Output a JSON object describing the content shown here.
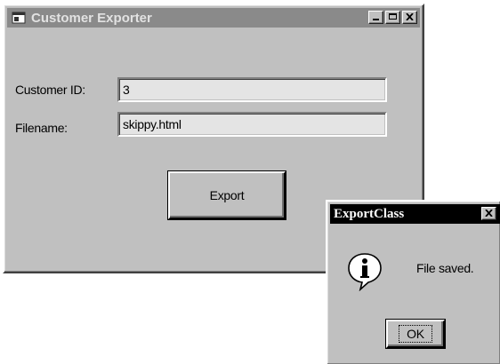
{
  "main_window": {
    "title": "Customer Exporter",
    "icon": "app-window-icon",
    "controls": [
      "minimize-icon",
      "maximize-icon",
      "close-icon"
    ],
    "customer_id_label": "Customer ID:",
    "customer_id_value": "3",
    "filename_label": "Filename:",
    "filename_value": "skippy.html",
    "export_button": "Export"
  },
  "message_box": {
    "title": "ExportClass",
    "icon": "info-icon",
    "message": "File saved.",
    "ok_button": "OK"
  },
  "colors": {
    "window_face": "#c0c0c0",
    "inactive_title": "#8a8a8a",
    "active_title": "#000000"
  }
}
